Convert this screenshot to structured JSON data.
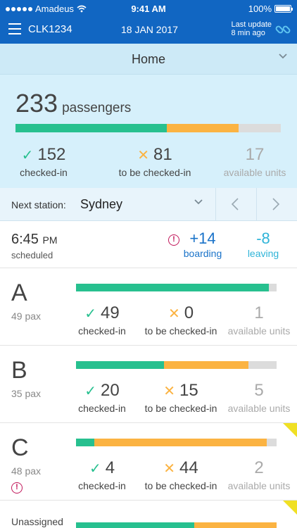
{
  "status_bar": {
    "carrier": "Amadeus",
    "time": "9:41 AM",
    "battery": "100%"
  },
  "app_bar": {
    "id": "CLK1234",
    "date": "18 JAN 2017",
    "last_update_line1": "Last update",
    "last_update_line2": "8 min ago"
  },
  "home": {
    "title": "Home"
  },
  "summary": {
    "total": "233",
    "unit": "passengers",
    "checked_in": "152",
    "to_be_checked_in": "81",
    "available": "17",
    "checked_in_label": "checked-in",
    "to_be_label": "to be checked-in",
    "available_label": "available units",
    "fill": {
      "checked": 0.57,
      "pending": 0.27
    }
  },
  "station": {
    "label": "Next station:",
    "name": "Sydney"
  },
  "departure": {
    "time": "6:45",
    "ampm": "PM",
    "scheduled": "scheduled",
    "boarding": "+14",
    "boarding_label": "boarding",
    "leaving": "-8",
    "leaving_label": "leaving"
  },
  "alert_glyph": "!",
  "coaches": [
    {
      "letter": "A",
      "pax": "49 pax",
      "checked_in": "49",
      "to_be": "0",
      "available": "1",
      "fill": {
        "checked": 0.96,
        "pending": 0.0
      }
    },
    {
      "letter": "B",
      "pax": "35 pax",
      "checked_in": "20",
      "to_be": "15",
      "available": "5",
      "fill": {
        "checked": 0.44,
        "pending": 0.42
      }
    },
    {
      "letter": "C",
      "pax": "48 pax",
      "checked_in": "4",
      "to_be": "44",
      "available": "2",
      "fill": {
        "checked": 0.09,
        "pending": 0.86
      }
    },
    {
      "letter": "Unassigned",
      "fill": {
        "checked": 0.59,
        "pending": 0.41
      }
    }
  ],
  "colors": {
    "primary": "#1166c2",
    "checked": "#27c08f",
    "pending": "#fbb342",
    "alert": "#c2185b",
    "flag": "#f0e024"
  }
}
